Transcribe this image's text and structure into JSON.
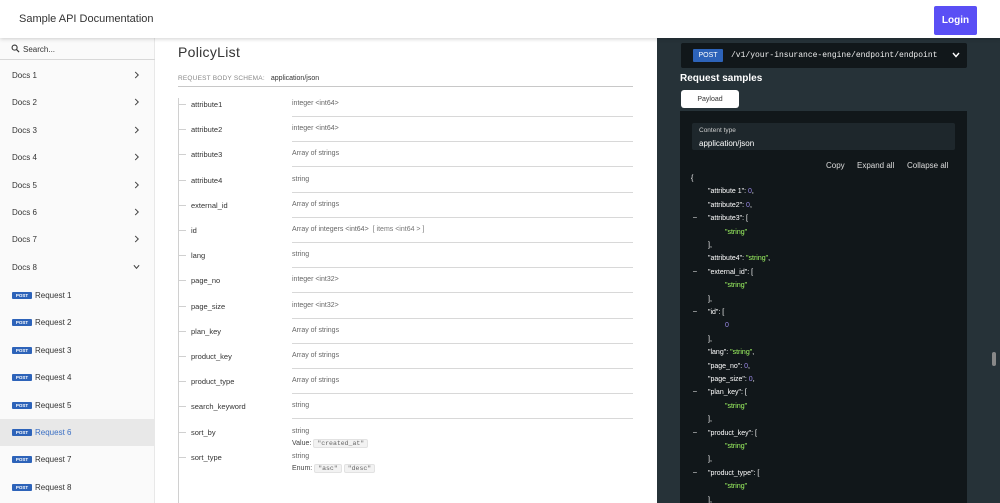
{
  "header": {
    "title": "Sample API Documentation",
    "login_label": "Login"
  },
  "search": {
    "placeholder": "Search..."
  },
  "sidebar": {
    "docs": [
      {
        "label": "Docs 1",
        "expanded": false
      },
      {
        "label": "Docs 2",
        "expanded": false
      },
      {
        "label": "Docs 3",
        "expanded": false
      },
      {
        "label": "Docs 4",
        "expanded": false
      },
      {
        "label": "Docs 5",
        "expanded": false
      },
      {
        "label": "Docs 6",
        "expanded": false
      },
      {
        "label": "Docs 7",
        "expanded": false
      },
      {
        "label": "Docs 8",
        "expanded": true
      }
    ],
    "requests": [
      {
        "method": "POST",
        "label": "Request 1",
        "active": false
      },
      {
        "method": "POST",
        "label": "Request 2",
        "active": false
      },
      {
        "method": "POST",
        "label": "Request 3",
        "active": false
      },
      {
        "method": "POST",
        "label": "Request 4",
        "active": false
      },
      {
        "method": "POST",
        "label": "Request 5",
        "active": false
      },
      {
        "method": "POST",
        "label": "Request 6",
        "active": true
      },
      {
        "method": "POST",
        "label": "Request 7",
        "active": false
      },
      {
        "method": "POST",
        "label": "Request 8",
        "active": false
      }
    ]
  },
  "main": {
    "title": "PolicyList",
    "schema_label": "REQUEST BODY SCHEMA:",
    "schema_value": "application/json",
    "properties": [
      {
        "name": "attribute1",
        "type": "integer <int64>"
      },
      {
        "name": "attribute2",
        "type": "integer <int64>"
      },
      {
        "name": "attribute3",
        "type": "Array of strings"
      },
      {
        "name": "attribute4",
        "type": "string"
      },
      {
        "name": "external_id",
        "type": "Array of strings"
      },
      {
        "name": "id",
        "type": "Array of integers <int64>",
        "extra": "[ items <int64 > ]"
      },
      {
        "name": "lang",
        "type": "string"
      },
      {
        "name": "page_no",
        "type": "integer <int32>"
      },
      {
        "name": "page_size",
        "type": "integer <int32>"
      },
      {
        "name": "plan_key",
        "type": "Array of strings"
      },
      {
        "name": "product_key",
        "type": "Array of strings"
      },
      {
        "name": "product_type",
        "type": "Array of strings"
      },
      {
        "name": "search_keyword",
        "type": "string"
      },
      {
        "name": "sort_by",
        "type": "string",
        "sub_label": "Value:",
        "sub_values": [
          "\"created_at\""
        ]
      },
      {
        "name": "sort_type",
        "type": "string",
        "sub_label": "Enum:",
        "sub_values": [
          "\"asc\"",
          "\"desc\""
        ]
      }
    ]
  },
  "right": {
    "method": "POST",
    "path": "/v1/your-insurance-engine/endpoint/endpoint",
    "samples_title": "Request samples",
    "payload_tab": "Payload",
    "content_type_label": "Content type",
    "content_type_value": "application/json",
    "copy": "Copy",
    "expand_all": "Expand all",
    "collapse_all": "Collapse all",
    "json_lines": [
      {
        "indent": 0,
        "parts": [
          {
            "t": "{",
            "c": "p"
          }
        ]
      },
      {
        "indent": 1,
        "parts": [
          {
            "t": "\"attribute 1\"",
            "c": "k"
          },
          {
            "t": ": ",
            "c": "p"
          },
          {
            "t": "0",
            "c": "num"
          },
          {
            "t": ",",
            "c": "p"
          }
        ]
      },
      {
        "indent": 1,
        "parts": [
          {
            "t": "\"attribute2\"",
            "c": "k"
          },
          {
            "t": ": ",
            "c": "p"
          },
          {
            "t": "0",
            "c": "num"
          },
          {
            "t": ",",
            "c": "p"
          }
        ]
      },
      {
        "indent": 1,
        "toggle": "–",
        "parts": [
          {
            "t": "\"attribute3\"",
            "c": "k"
          },
          {
            "t": ": [",
            "c": "p"
          }
        ]
      },
      {
        "indent": 2,
        "parts": [
          {
            "t": "\"string\"",
            "c": "str"
          }
        ]
      },
      {
        "indent": 1,
        "parts": [
          {
            "t": "],",
            "c": "p"
          }
        ]
      },
      {
        "indent": 1,
        "parts": [
          {
            "t": "\"attribute4\"",
            "c": "k"
          },
          {
            "t": ": ",
            "c": "p"
          },
          {
            "t": "\"string\"",
            "c": "str"
          },
          {
            "t": ",",
            "c": "p"
          }
        ]
      },
      {
        "indent": 1,
        "toggle": "–",
        "parts": [
          {
            "t": "\"external_id\"",
            "c": "k"
          },
          {
            "t": ": [",
            "c": "p"
          }
        ]
      },
      {
        "indent": 2,
        "parts": [
          {
            "t": "\"string\"",
            "c": "str"
          }
        ]
      },
      {
        "indent": 1,
        "parts": [
          {
            "t": "],",
            "c": "p"
          }
        ]
      },
      {
        "indent": 1,
        "toggle": "–",
        "parts": [
          {
            "t": "\"id\"",
            "c": "k"
          },
          {
            "t": ": [",
            "c": "p"
          }
        ]
      },
      {
        "indent": 2,
        "parts": [
          {
            "t": "0",
            "c": "num"
          }
        ]
      },
      {
        "indent": 1,
        "parts": [
          {
            "t": "],",
            "c": "p"
          }
        ]
      },
      {
        "indent": 1,
        "parts": [
          {
            "t": "\"lang\"",
            "c": "k"
          },
          {
            "t": ": ",
            "c": "p"
          },
          {
            "t": "\"string\"",
            "c": "str"
          },
          {
            "t": ",",
            "c": "p"
          }
        ]
      },
      {
        "indent": 1,
        "parts": [
          {
            "t": "\"page_no\"",
            "c": "k"
          },
          {
            "t": ": ",
            "c": "p"
          },
          {
            "t": "0",
            "c": "num"
          },
          {
            "t": ",",
            "c": "p"
          }
        ]
      },
      {
        "indent": 1,
        "parts": [
          {
            "t": "\"page_size\"",
            "c": "k"
          },
          {
            "t": ": ",
            "c": "p"
          },
          {
            "t": "0",
            "c": "num"
          },
          {
            "t": ",",
            "c": "p"
          }
        ]
      },
      {
        "indent": 1,
        "toggle": "–",
        "parts": [
          {
            "t": "\"plan_key\"",
            "c": "k"
          },
          {
            "t": ": [",
            "c": "p"
          }
        ]
      },
      {
        "indent": 2,
        "parts": [
          {
            "t": "\"string\"",
            "c": "str"
          }
        ]
      },
      {
        "indent": 1,
        "parts": [
          {
            "t": "],",
            "c": "p"
          }
        ]
      },
      {
        "indent": 1,
        "toggle": "–",
        "parts": [
          {
            "t": "\"product_key\"",
            "c": "k"
          },
          {
            "t": ": [",
            "c": "p"
          }
        ]
      },
      {
        "indent": 2,
        "parts": [
          {
            "t": "\"string\"",
            "c": "str"
          }
        ]
      },
      {
        "indent": 1,
        "parts": [
          {
            "t": "],",
            "c": "p"
          }
        ]
      },
      {
        "indent": 1,
        "toggle": "–",
        "parts": [
          {
            "t": "\"product_type\"",
            "c": "k"
          },
          {
            "t": ": [",
            "c": "p"
          }
        ]
      },
      {
        "indent": 2,
        "parts": [
          {
            "t": "\"string\"",
            "c": "str"
          }
        ]
      },
      {
        "indent": 1,
        "parts": [
          {
            "t": "],",
            "c": "p"
          }
        ]
      }
    ]
  },
  "colors": {
    "accent": "#5a4ff5",
    "post_badge": "#2d63b9",
    "dark_panel": "#263238",
    "json_string": "#a0fa63",
    "json_number": "#9b8ae8"
  },
  "icons": {
    "search": "search-icon",
    "chevron_right": "chevron-right-icon",
    "chevron_down": "chevron-down-icon"
  }
}
